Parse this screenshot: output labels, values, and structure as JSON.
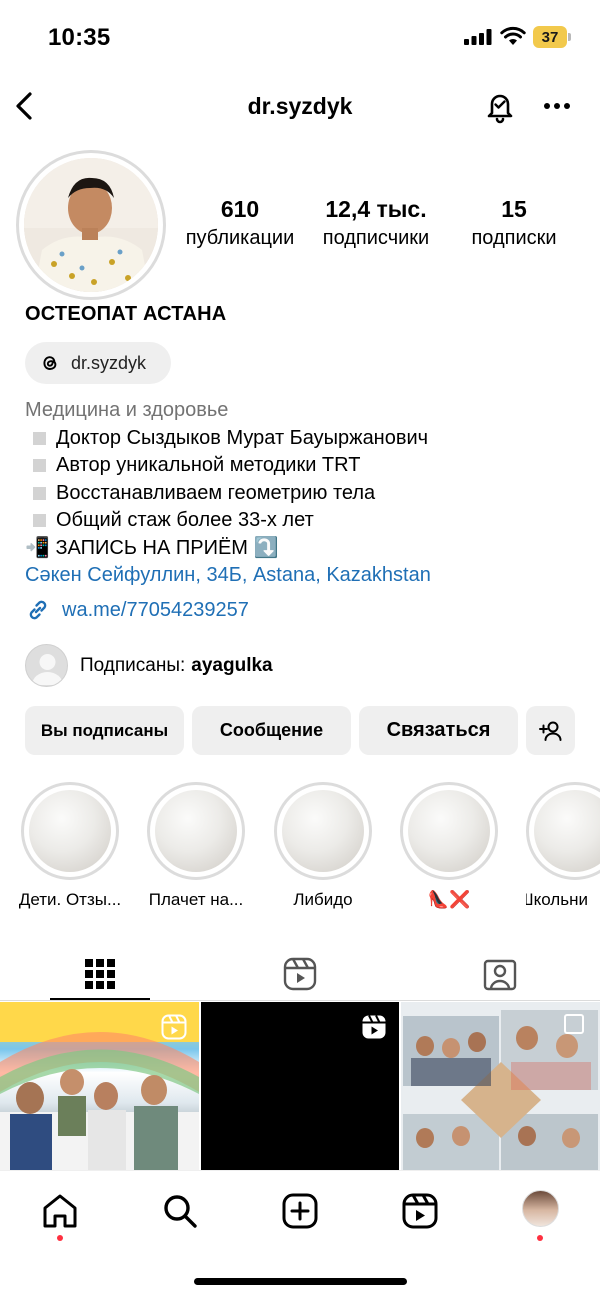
{
  "status_bar": {
    "time": "10:35",
    "battery_level": "37",
    "icons": [
      "cellular-signal-icon",
      "wifi-icon",
      "battery-icon"
    ]
  },
  "header": {
    "username": "dr.syzdyk",
    "icons": [
      "back-chevron-icon",
      "notification-bell-icon",
      "more-dots-icon"
    ]
  },
  "stats": {
    "posts_count": "610",
    "posts_label": "публикации",
    "followers_count": "12,4 тыс.",
    "followers_label": "подписчики",
    "following_count": "15",
    "following_label": "подписки"
  },
  "profile": {
    "name": "ОСТЕОПАТ АСТАНА",
    "threads_handle": "dr.syzdyk",
    "category": "Медицина и здоровье",
    "bio_lines": [
      "Доктор Сыздыков Мурат Бауыржанович",
      "Автор уникальной методики TRT",
      "Восстанавливаем геометрию тела",
      "Общий стаж более 33-х лет"
    ],
    "booking_line": "📲 ЗАПИСЬ НА ПРИЁМ ⤵️",
    "location": "Сәкен Сейфуллин, 34Б, Astana, Kazakhstan",
    "link": "wa.me/77054239257"
  },
  "followed_by": {
    "label": "Подписаны:",
    "name": "ayagulka"
  },
  "buttons": {
    "following": "Вы подписаны",
    "message": "Сообщение",
    "contact": "Связаться"
  },
  "highlights": [
    {
      "label": "Дети. Отзы..."
    },
    {
      "label": "Плачет на..."
    },
    {
      "label": "Либидо"
    },
    {
      "label": "👠❌"
    },
    {
      "label": "Школьни"
    }
  ],
  "tabs": [
    "grid-tab",
    "reels-tab",
    "tagged-tab"
  ],
  "colors": {
    "link": "#1f6fb5",
    "secondary_text": "#737373",
    "button_bg": "#efefef",
    "notification_dot": "#ff3040",
    "battery": "#f2c94c"
  }
}
